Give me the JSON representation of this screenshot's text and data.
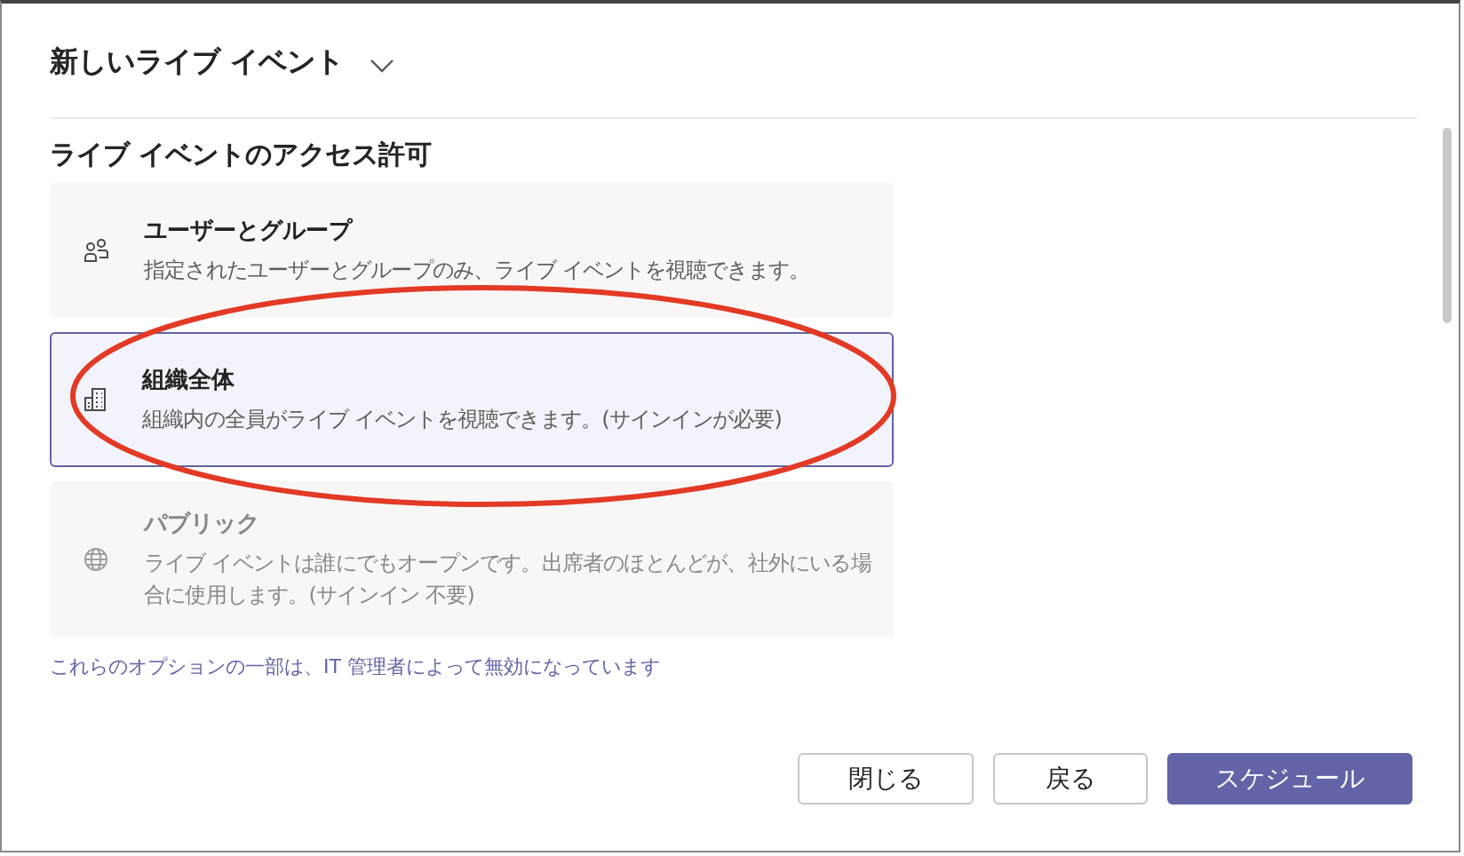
{
  "dialog": {
    "title": "新しいライブ イベント",
    "section_heading": "ライブ イベントのアクセス許可",
    "options": [
      {
        "title": "ユーザーとグループ",
        "description": "指定されたユーザーとグループのみ、ライブ イベントを視聴できます。",
        "selected": false,
        "disabled": false
      },
      {
        "title": "組織全体",
        "description": "組織内の全員がライブ イベントを視聴できます。(サインインが必要)",
        "selected": true,
        "disabled": false
      },
      {
        "title": "パブリック",
        "description": "ライブ イベントは誰にでもオープンです。出席者のほとんどが、社外にいる場合に使用します。(サインイン 不要)",
        "selected": false,
        "disabled": true
      }
    ],
    "note": "これらのオプションの一部は、IT 管理者によって無効になっています",
    "buttons": [
      {
        "label": "閉じる",
        "kind": "secondary"
      },
      {
        "label": "戻る",
        "kind": "secondary"
      },
      {
        "label": "スケジュール",
        "kind": "primary"
      }
    ]
  }
}
